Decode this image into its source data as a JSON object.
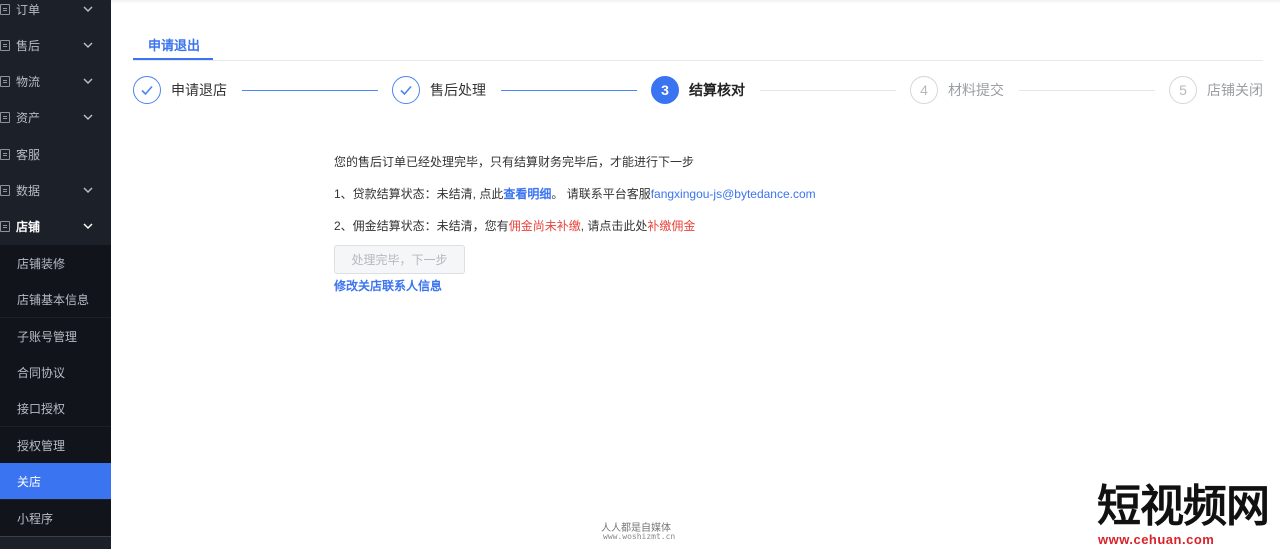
{
  "sidebar": {
    "menu": [
      {
        "label": "订单",
        "expandable": true
      },
      {
        "label": "售后",
        "expandable": true
      },
      {
        "label": "物流",
        "expandable": true
      },
      {
        "label": "资产",
        "expandable": true
      },
      {
        "label": "客服",
        "expandable": false
      },
      {
        "label": "数据",
        "expandable": true
      },
      {
        "label": "店铺",
        "expandable": true
      }
    ],
    "submenu": [
      {
        "label": "店铺装修"
      },
      {
        "label": "店铺基本信息"
      },
      {
        "label": "子账号管理"
      },
      {
        "label": "合同协议"
      },
      {
        "label": "接口授权"
      },
      {
        "label": "授权管理"
      },
      {
        "label": "关店"
      },
      {
        "label": "小程序"
      }
    ],
    "active_submenu": "关店"
  },
  "tabs": [
    {
      "label": "申请退出",
      "active": true
    }
  ],
  "steps": [
    {
      "number": "1",
      "label": "申请退店",
      "status": "done"
    },
    {
      "number": "2",
      "label": "售后处理",
      "status": "done"
    },
    {
      "number": "3",
      "label": "结算核对",
      "status": "current"
    },
    {
      "number": "4",
      "label": "材料提交",
      "status": "pending"
    },
    {
      "number": "5",
      "label": "店铺关闭",
      "status": "pending"
    }
  ],
  "notice": {
    "intro": "您的售后订单已经处理完毕，只有结算财务完毕后，才能进行下一步",
    "line1": {
      "prefix": "1、贷款结算状态：未结清, 点此",
      "link": "查看明细",
      "mid": "。 请联系平台客服",
      "email": "fangxingou-js@bytedance.com"
    },
    "line2": {
      "prefix": "2、佣金结算状态：未结清，您有",
      "warn1": "佣金尚未补缴",
      "mid": ", 请点击此处",
      "warn2": "补缴佣金"
    }
  },
  "actions": {
    "next_button": "处理完毕，下一步",
    "edit_contact": "修改关店联系人信息"
  },
  "watermarks": {
    "site_cn": "人人都是自媒体",
    "site_url": "www.woshizmt.cn",
    "logo_text": "短视频网",
    "logo_url": "www.cehuan.com"
  },
  "colors": {
    "accent": "#3b74f0",
    "warning": "#e8453c",
    "sidebar_bg": "#1b2029"
  }
}
